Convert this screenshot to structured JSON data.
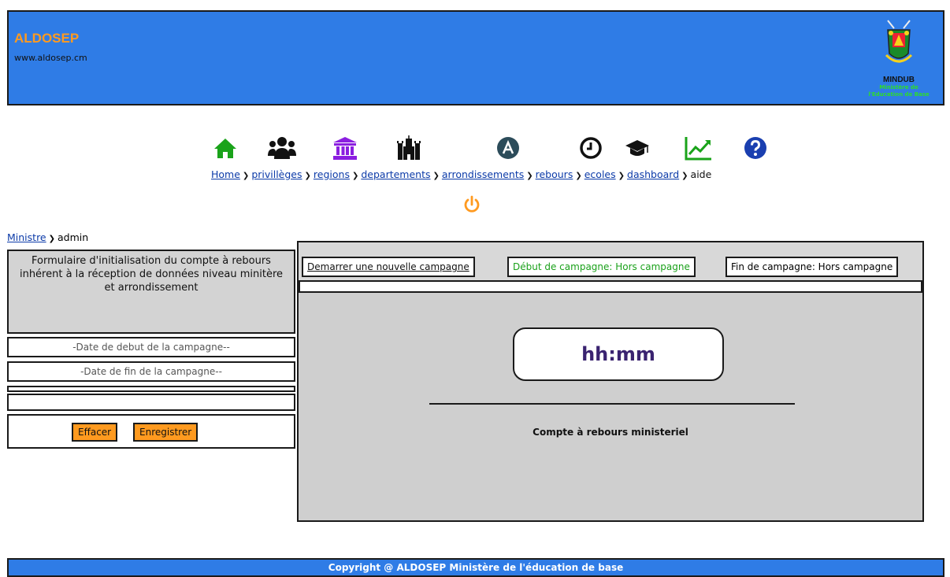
{
  "header": {
    "brand": "ALDOSEP",
    "site": "www.aldosep.cm",
    "emblem_title": "MINDUB",
    "emblem_sub_1": "Ministère de",
    "emblem_sub_2": "l'Education de Base"
  },
  "nav": {
    "icons": [
      "home-icon",
      "users-icon",
      "bank-icon",
      "castle-icon",
      "letter-a-icon",
      "clock-icon",
      "graduation-cap-icon",
      "chart-icon",
      "help-icon"
    ],
    "items": [
      {
        "label": "Home"
      },
      {
        "label": "privillèges"
      },
      {
        "label": "regions"
      },
      {
        "label": "departements"
      },
      {
        "label": "arrondissements"
      },
      {
        "label": "rebours"
      },
      {
        "label": "ecoles"
      },
      {
        "label": "dashboard"
      },
      {
        "label": "aide"
      }
    ]
  },
  "subcrumb": {
    "parent": "Ministre",
    "current": "admin"
  },
  "form": {
    "intro": "Formulaire d'initialisation du compte à rebours inhérent à la réception de données niveau minitère et arrondissement",
    "start_placeholder": "-Date de debut de la campagne--",
    "end_placeholder": "-Date de fin de la campagne--",
    "clear_label": "Effacer",
    "save_label": "Enregistrer"
  },
  "main": {
    "start_campaign": "Demarrer une nouvelle campagne",
    "start_status": "Début de campagne: Hors campagne",
    "end_status": "Fin de campagne: Hors campagne",
    "clock": "hh:mm",
    "caption": "Compte à rebours ministeriel"
  },
  "footer": {
    "text": "Copyright  @  ALDOSEP Ministère de l'éducation de base"
  },
  "colors": {
    "header_blue": "#2f7ce6",
    "accent_orange": "#ff9a1f",
    "green": "#1aa11a"
  }
}
